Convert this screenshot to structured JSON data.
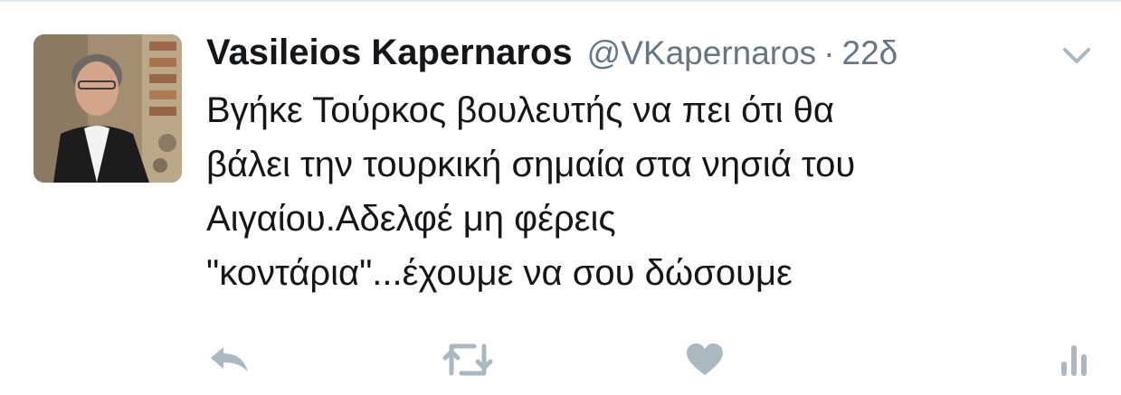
{
  "tweet": {
    "author": {
      "display_name": "Vasileios Kapernaros",
      "handle": "@VKapernaros",
      "avatar_icon": "profile-photo"
    },
    "separator": "·",
    "time": "22δ",
    "text_lines": [
      "Βγήκε Τούρκος βουλευτής να πει ότι θα",
      "βάλει την τουρκική σημαία στα νησιά του",
      "Αιγαίου.Αδελφέ μη φέρεις",
      "\"κοντάρια\"...έχουμε να σου δώσουμε"
    ],
    "actions": {
      "reply_icon": "reply-icon",
      "retweet_icon": "retweet-icon",
      "like_icon": "heart-icon",
      "analytics_icon": "analytics-icon"
    },
    "colors": {
      "text": "#14171a",
      "secondary": "#657786",
      "action_icons": "#aab8c2",
      "divider": "#e1e8ed"
    }
  }
}
